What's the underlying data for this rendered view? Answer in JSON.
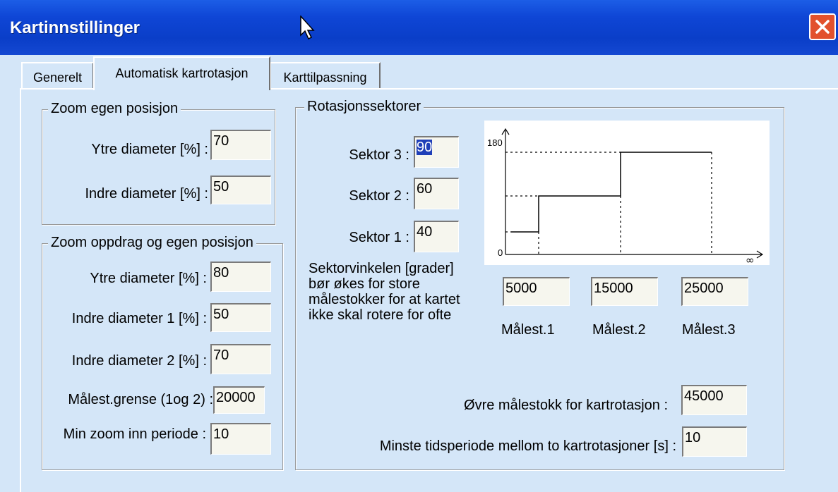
{
  "window": {
    "title": "Kartinnstillinger"
  },
  "tabs": [
    {
      "label": "Generelt",
      "active": false
    },
    {
      "label": "Automatisk kartrotasjon",
      "active": true
    },
    {
      "label": "Karttilpassning",
      "active": false
    }
  ],
  "zoom_own": {
    "legend": "Zoom egen posisjon",
    "outer_label": "Ytre diameter [%] :",
    "outer_value": "70",
    "inner_label": "Indre diameter [%] :",
    "inner_value": "50"
  },
  "zoom_task": {
    "legend": "Zoom oppdrag og egen posisjon",
    "outer_label": "Ytre diameter [%] :",
    "outer_value": "80",
    "inner1_label": "Indre diameter 1 [%] :",
    "inner1_value": "50",
    "inner2_label": "Indre diameter 2 [%] :",
    "inner2_value": "70",
    "limit_label": "Målest.grense (1og 2) :",
    "limit_value": "20000",
    "min_zoom_label": "Min zoom inn periode :",
    "min_zoom_value": "10"
  },
  "sectors": {
    "legend": "Rotasjonssektorer",
    "s3_label": "Sektor 3 :",
    "s3_value": "90",
    "s2_label": "Sektor 2 :",
    "s2_value": "60",
    "s1_label": "Sektor 1 :",
    "s1_value": "40",
    "description": "Sektorvinkelen [grader] bør økes for store målestokker for at kartet ikke skal rotere for ofte",
    "chart": {
      "y_max": "180",
      "y_zero": "0",
      "x_inf": "∞"
    },
    "scales": [
      {
        "value": "5000",
        "label": "Målest.1"
      },
      {
        "value": "15000",
        "label": "Målest.2"
      },
      {
        "value": "25000",
        "label": "Målest.3"
      }
    ],
    "upper_scale_label": "Øvre målestokk for kartrotasjon :",
    "upper_scale_value": "45000",
    "min_period_label": "Minste tidsperiode mellom to kartrotasjoner  [s] :",
    "min_period_value": "10"
  }
}
